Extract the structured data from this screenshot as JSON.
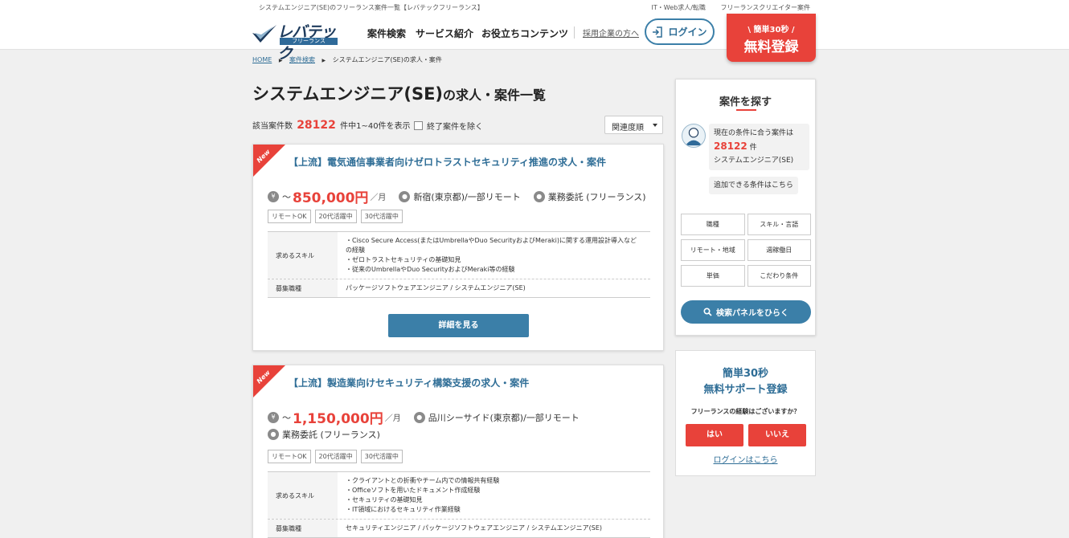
{
  "topbar": {
    "seo_text": "システムエンジニア(SE)のフリーランス案件一覧【レバテックフリーランス】",
    "links": [
      "IT・Web求人/転職",
      "フリーランスクリエイター案件"
    ]
  },
  "header": {
    "logo_main": "レバテック",
    "logo_sub": "フリーランス",
    "nav": [
      "案件検索",
      "サービス紹介",
      "お役立ちコンテンツ"
    ],
    "employer_link": "採用企業の方へ",
    "login_label": "ログイン",
    "register_small": "\\ 簡単30秒 /",
    "register_big": "無料登録"
  },
  "breadcrumb": [
    "HOME",
    "案件検索",
    "システムエンジニア(SE)の求人・案件"
  ],
  "page": {
    "title_main": "システムエンジニア(SE)",
    "title_suffix": "の求人・案件一覧",
    "count_prefix": "該当案件数",
    "count_value": "28122",
    "count_suffix": "件中1~40件を表示",
    "exclude_label": "終了案件を除く",
    "sort_label": "関連度順"
  },
  "jobs": [
    {
      "badge": "New",
      "title": "【上流】電気通信事業者向けゼロトラストセキュリティ推進の求人・案件",
      "price_prefix": "～",
      "price": "850,000円",
      "price_unit": "／月",
      "location": "新宿(東京都)/一部リモート",
      "contract": "業務委託 (フリーランス)",
      "tags": [
        "リモートOK",
        "20代活躍中",
        "30代活躍中"
      ],
      "skills_label": "求めるスキル",
      "skills": [
        "・Cisco Secure Access(またはUmbrellaやDuo SecurityおよびMeraki)に関する運用設計導入などの経験",
        "・ゼロトラストセキュリティの基礎知見",
        "・従来のUmbrellaやDuo SecurityおよびMeraki等の経験"
      ],
      "role_label": "募集職種",
      "role": "パッケージソフトウェアエンジニア / システムエンジニア(SE)",
      "detail_label": "詳細を見る"
    },
    {
      "badge": "New",
      "title": "【上流】製造業向けセキュリティ構築支援の求人・案件",
      "price_prefix": "～",
      "price": "1,150,000円",
      "price_unit": "／月",
      "location": "品川シーサイド(東京都)/一部リモート",
      "contract": "業務委託 (フリーランス)",
      "tags": [
        "リモートOK",
        "20代活躍中",
        "30代活躍中"
      ],
      "skills_label": "求めるスキル",
      "skills": [
        "・クライアントとの折衝やチーム内での情報共有経験",
        "・Officeソフトを用いたドキュメント作成経験",
        "・セキュリティの基礎知見",
        "・IT領域におけるセキュリティ作業経験"
      ],
      "role_label": "募集職種",
      "role": "セキュリティエンジニア / パッケージソフトウェアエンジニア / システムエンジニア(SE)"
    }
  ],
  "search_panel": {
    "heading": "案件を探す",
    "bubble_line1": "現在の条件に合う案件は",
    "bubble_count": "28122",
    "bubble_unit": "件",
    "bubble_line3": "システムエンジニア(SE)",
    "add_conditions": "追加できる条件はこちら",
    "filters": [
      "職種",
      "スキル・言語",
      "リモート・地域",
      "週稼働日",
      "単価",
      "こだわり条件"
    ],
    "open_label": "検索パネルをひらく"
  },
  "support": {
    "title_line1": "簡単30秒",
    "title_line2": "無料サポート登録",
    "question": "フリーランスの経験はございますか？",
    "yes": "はい",
    "no": "いいえ",
    "login_link": "ログインはこちら"
  },
  "colors": {
    "accent": "#e8423a",
    "brand": "#3b7fa8"
  }
}
